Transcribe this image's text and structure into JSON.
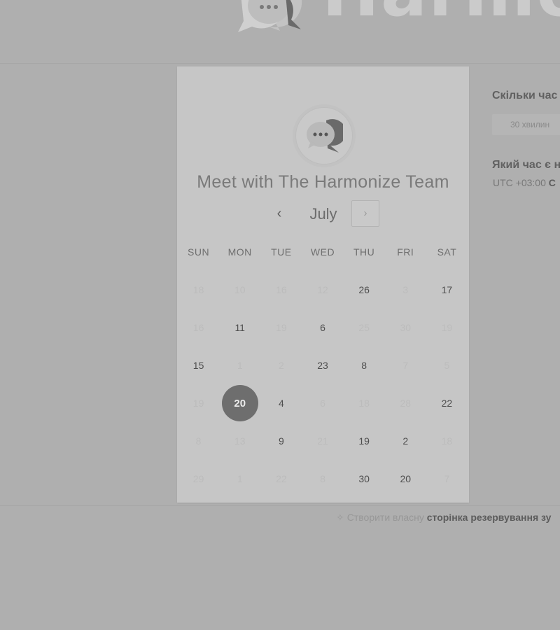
{
  "brand": {
    "name": "Harmo"
  },
  "calendar": {
    "title": "Meet with The Harmonize Team",
    "month": "July",
    "prev_icon": "‹",
    "next_icon": "›",
    "weekdays": [
      "SUN",
      "MON",
      "TUE",
      "WED",
      "THU",
      "FRI",
      "SAT"
    ],
    "weeks": [
      [
        {
          "d": "18",
          "s": "off"
        },
        {
          "d": "10",
          "s": "off"
        },
        {
          "d": "16",
          "s": "off"
        },
        {
          "d": "12",
          "s": "off"
        },
        {
          "d": "26",
          "s": "on"
        },
        {
          "d": "3",
          "s": "off"
        },
        {
          "d": "17",
          "s": "on"
        }
      ],
      [
        {
          "d": "16",
          "s": "off"
        },
        {
          "d": "11",
          "s": "on"
        },
        {
          "d": "19",
          "s": "off"
        },
        {
          "d": "6",
          "s": "on"
        },
        {
          "d": "25",
          "s": "off"
        },
        {
          "d": "30",
          "s": "off"
        },
        {
          "d": "19",
          "s": "off"
        }
      ],
      [
        {
          "d": "15",
          "s": "on"
        },
        {
          "d": "1",
          "s": "off"
        },
        {
          "d": "2",
          "s": "off"
        },
        {
          "d": "23",
          "s": "on"
        },
        {
          "d": "8",
          "s": "on"
        },
        {
          "d": "7",
          "s": "off"
        },
        {
          "d": "5",
          "s": "off"
        }
      ],
      [
        {
          "d": "19",
          "s": "off"
        },
        {
          "d": "20",
          "s": "sel"
        },
        {
          "d": "4",
          "s": "on"
        },
        {
          "d": "6",
          "s": "off"
        },
        {
          "d": "18",
          "s": "off"
        },
        {
          "d": "28",
          "s": "off"
        },
        {
          "d": "22",
          "s": "on"
        }
      ],
      [
        {
          "d": "8",
          "s": "off"
        },
        {
          "d": "13",
          "s": "off"
        },
        {
          "d": "9",
          "s": "on"
        },
        {
          "d": "21",
          "s": "off"
        },
        {
          "d": "19",
          "s": "on"
        },
        {
          "d": "2",
          "s": "on"
        },
        {
          "d": "18",
          "s": "off"
        }
      ],
      [
        {
          "d": "29",
          "s": "off"
        },
        {
          "d": "1",
          "s": "off"
        },
        {
          "d": "22",
          "s": "off"
        },
        {
          "d": "8",
          "s": "off"
        },
        {
          "d": "30",
          "s": "on"
        },
        {
          "d": "20",
          "s": "on"
        },
        {
          "d": "7",
          "s": "off"
        }
      ]
    ]
  },
  "panel": {
    "duration_question": "Скільки час",
    "duration_option": "30 хвилин",
    "time_question": "Який час є н",
    "timezone_prefix": "UTC +03:00",
    "timezone_bold": "С"
  },
  "promo": {
    "icon": "spark-icon",
    "light_text": "Створити власну",
    "bold_text": "сторінка резервування зу"
  }
}
